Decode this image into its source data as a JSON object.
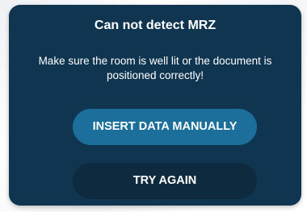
{
  "dialog": {
    "title": "Can not detect MRZ",
    "message": "Make sure the room is well lit or the document is positioned correctly!",
    "primary_button_label": "INSERT DATA MANUALLY",
    "secondary_button_label": "TRY AGAIN"
  },
  "colors": {
    "dialog_background": "#0f3550",
    "primary_button": "#1b6f9a",
    "secondary_button": "#0d2a3e",
    "text": "#ffffff"
  }
}
